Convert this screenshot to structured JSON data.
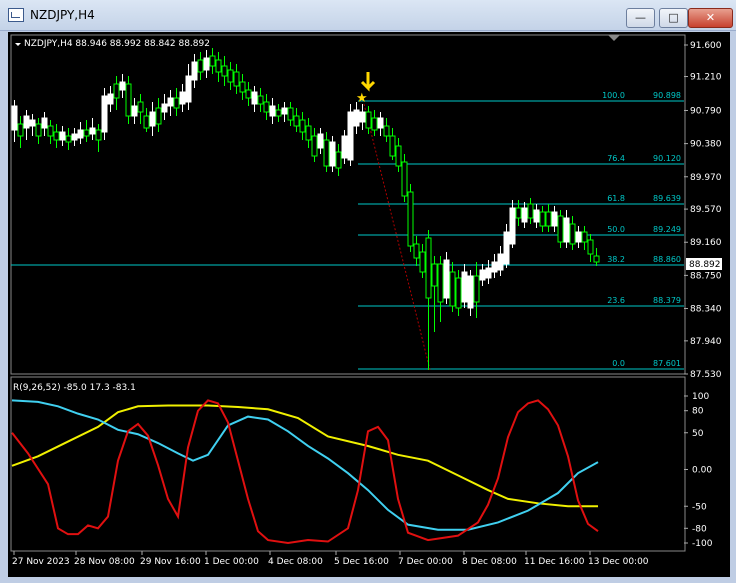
{
  "window": {
    "title": "NZDJPY,H4",
    "buttons": {
      "minimize": "—",
      "maximize": "□",
      "close": "✕"
    }
  },
  "chart": {
    "header": "NZDJPY,H4  88.946 88.992 88.842 88.892",
    "current_price": "88.892",
    "price_ticks": [
      "91.600",
      "91.210",
      "90.790",
      "90.380",
      "89.970",
      "89.570",
      "89.160",
      "88.750",
      "88.340",
      "87.940",
      "87.530"
    ],
    "fib_levels": [
      {
        "pct": "100.0",
        "price": "90.898"
      },
      {
        "pct": "76.4",
        "price": "90.120"
      },
      {
        "pct": "61.8",
        "price": "89.639"
      },
      {
        "pct": "50.0",
        "price": "89.249"
      },
      {
        "pct": "38.2",
        "price": "88.860"
      },
      {
        "pct": "23.6",
        "price": "88.379"
      },
      {
        "pct": "0.0",
        "price": "87.601"
      }
    ],
    "indicator_label": "R(9,26,52) -85.0 17.3 -83.1",
    "indicator_ticks": [
      "100",
      "80",
      "50",
      "0.00",
      "-50",
      "-80",
      "-100"
    ],
    "time_labels": [
      "27 Nov 2023",
      "28 Nov 08:00",
      "29 Nov 16:00",
      "1 Dec 00:00",
      "4 Dec 08:00",
      "5 Dec 16:00",
      "7 Dec 00:00",
      "8 Dec 08:00",
      "11 Dec 16:00",
      "13 Dec 00:00"
    ],
    "colors": {
      "bg": "#000000",
      "bull": "#ffffff",
      "bear": "#00ff00",
      "fib": "#00c8c8",
      "price_label_bg": "#ffffff",
      "arrow": "#ffd700",
      "line_red": "#e01010",
      "line_cyan": "#40d0f0",
      "line_yellow": "#f0f000"
    }
  }
}
